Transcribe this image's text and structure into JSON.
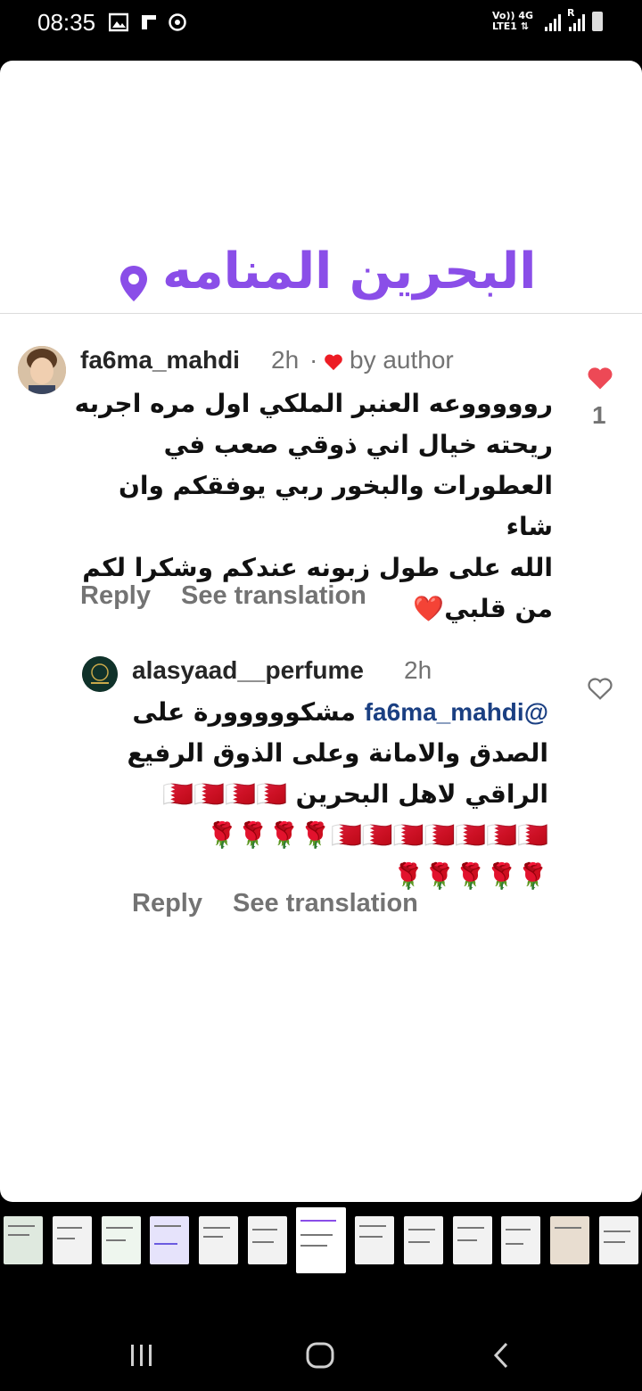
{
  "status_bar": {
    "time": "08:35",
    "network_line1": "Vo))",
    "network_line2": "LTE1",
    "network_type": "4G",
    "roaming": "R"
  },
  "post": {
    "sticker_text": "البحرين المنامه",
    "sticker_color": "#8a4ee8"
  },
  "comments": [
    {
      "username": "fa6ma_mahdi",
      "time": "2h",
      "separator": "·",
      "liked_by_author": "by author",
      "text_lines": [
        "روووووعه العنبر الملكي اول مره اجربه",
        "ريحته خيال اني ذوقي صعب في",
        "العطورات والبخور  ربي يوفقكم وان شاء",
        "الله على طول زبونه عندكم وشكرا لكم",
        "من قلبي❤️"
      ],
      "like_count": "1",
      "liked": true,
      "reply_label": "Reply",
      "translate_label": "See translation"
    },
    {
      "username": "alasyaad__perfume",
      "time": "2h",
      "mention": "@fa6ma_mahdi",
      "text_line1_rest": " مشكووووورة على",
      "text_lines": [
        "الصدق والامانة وعلى الذوق الرفيع",
        "الراقي لاهل البحرين 🇧🇭🇧🇭🇧🇭🇧🇭",
        "🇧🇭🇧🇭🇧🇭🇧🇭🇧🇭🇧🇭🇧🇭🌹🌹🌹🌹",
        "🌹🌹🌹🌹🌹"
      ],
      "liked": false,
      "reply_label": "Reply",
      "translate_label": "See translation"
    }
  ],
  "colors": {
    "heart_red": "#ed4956",
    "text": "#262626",
    "muted": "#737373"
  },
  "nav_icons": [
    "recent-apps-icon",
    "home-icon",
    "back-icon"
  ]
}
